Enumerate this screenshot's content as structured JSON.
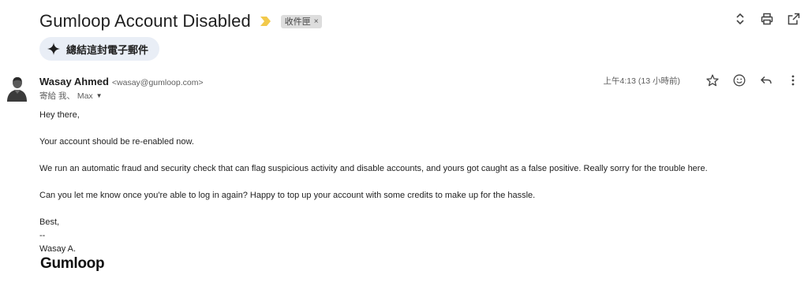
{
  "email": {
    "subject": "Gumloop Account Disabled",
    "label": "收件匣",
    "label_remove": "×",
    "summary_button": "總結這封電子郵件",
    "sender": {
      "name": "Wasay Ahmed",
      "email": "<wasay@gumloop.com>"
    },
    "recipients": "寄給 我、 Max",
    "timestamp": "上午4:13 (13 小時前)",
    "body": {
      "greeting": "Hey there,",
      "line1": "Your account should be re-enabled now.",
      "line2": "We run an automatic fraud and security check that can flag suspicious activity and disable accounts, and yours got caught as a false positive. Really sorry for the trouble here.",
      "line3": "Can you let me know once you're able to log in again? Happy to top up your account with some credits to make up for the hassle.",
      "signoff": "Best,",
      "dash": "--",
      "signature": "Wasay A.",
      "logo_text": "Gumloop"
    }
  },
  "icons": {
    "importance": "importance-marker-icon",
    "expand": "expand-collapse-icon",
    "print": "print-icon",
    "new_window": "open-in-new-window-icon",
    "sparkle": "sparkle-icon",
    "star": "star-icon",
    "emoji": "emoji-reaction-icon",
    "reply": "reply-icon",
    "more": "more-vert-icon"
  },
  "colors": {
    "importance": "#f2c94c",
    "chip_bg": "#dddddd",
    "summary_bg": "#e9eef6",
    "text": "#1f1f1f",
    "muted": "#5e5e5e"
  }
}
